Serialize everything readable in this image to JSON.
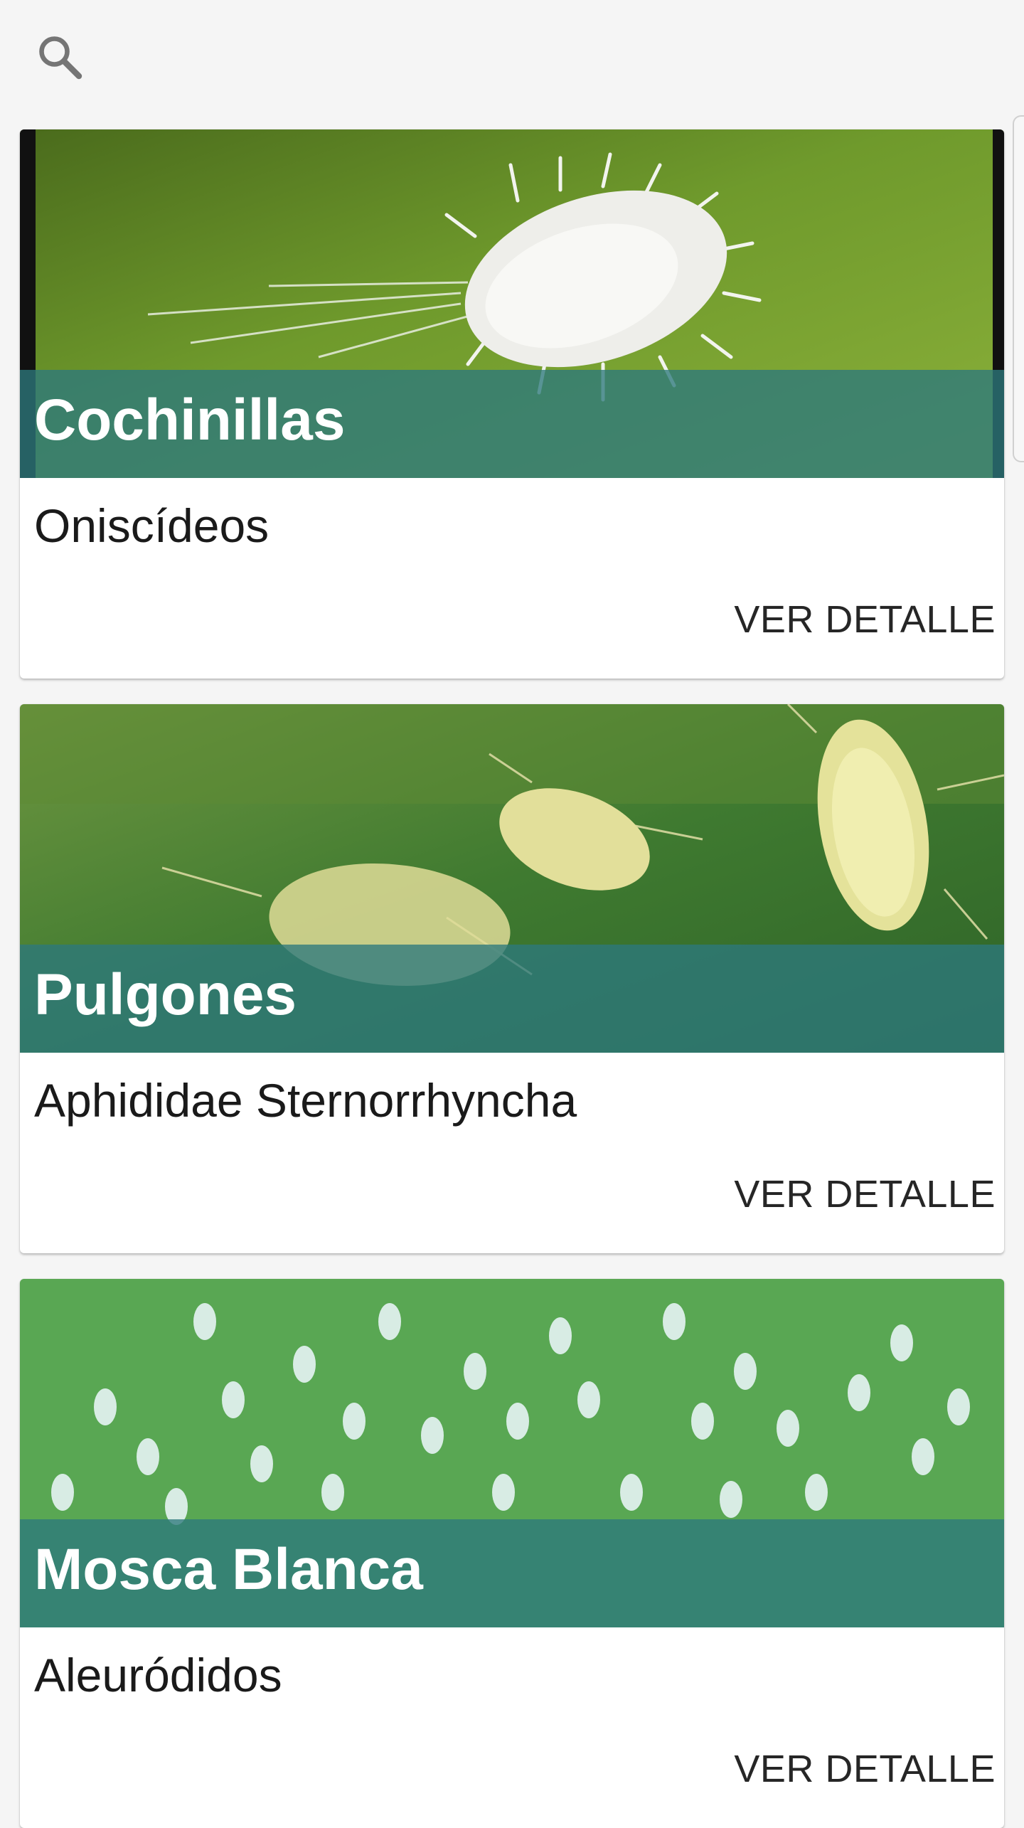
{
  "search": {
    "icon": "search-icon"
  },
  "colors": {
    "background": "#f5f5f5",
    "title_band": "#2d787c",
    "card": "#ffffff",
    "icon": "#757575"
  },
  "cards": [
    {
      "title": "Cochinillas",
      "subtitle": "Oniscídeos",
      "action": "VER DETALLE",
      "image": "mealybug-on-leaf"
    },
    {
      "title": "Pulgones",
      "subtitle": "Aphididae Sternorrhyncha",
      "action": "VER DETALLE",
      "image": "aphids-on-leaf"
    },
    {
      "title": "Mosca Blanca",
      "subtitle": "Aleuródidos",
      "action": "VER DETALLE",
      "image": "whiteflies-on-leaf"
    }
  ]
}
